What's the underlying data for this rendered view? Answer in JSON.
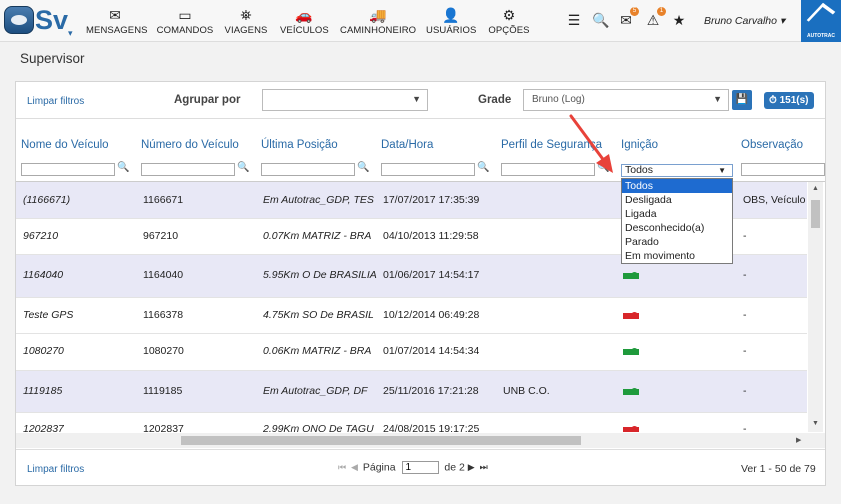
{
  "app": {
    "logo_text": "Sv",
    "logo_caret": "▾"
  },
  "nav": [
    {
      "icon": "✉",
      "label": "MENSAGENS"
    },
    {
      "icon": "▭",
      "label": "COMANDOS"
    },
    {
      "icon": "⛯",
      "label": "VIAGENS"
    },
    {
      "icon": "🚗",
      "label": "VEÍCULOS"
    },
    {
      "icon": "🚚",
      "label": "CAMINHONEIRO"
    },
    {
      "icon": "👤",
      "label": "USUÁRIOS"
    },
    {
      "icon": "⚙",
      "label": "OPÇÕES"
    }
  ],
  "top_icons": {
    "list": "☰",
    "search": "🔍",
    "mail": "✉",
    "mail_badge": "5",
    "alert": "⚠",
    "alert_badge": "1",
    "star": "★"
  },
  "user": {
    "name": "Bruno Carvalho ▾"
  },
  "brand": {
    "label": "AUTOTRAC"
  },
  "page": {
    "title": "Supervisor"
  },
  "toolbar": {
    "clear_filters": "Limpar filtros",
    "group_by_label": "Agrupar por",
    "group_by_value": "",
    "grade_label": "Grade",
    "grade_value": "Bruno (Log)",
    "save_icon": "💾",
    "count_badge": "⏱ 151(s)"
  },
  "columns": [
    "Nome do Veículo",
    "Número do Veículo",
    "Última Posição",
    "Data/Hora",
    "Perfil de Segurança",
    "Ignição",
    "Observação"
  ],
  "rows": [
    {
      "name": "(1166671)",
      "number": "1166671",
      "position": "Em Autotrac_GDP, TES",
      "datetime": "17/07/2017 17:35:39",
      "profile": "",
      "ignition": "",
      "obs": "OBS, Veículo"
    },
    {
      "name": "967210",
      "number": "967210",
      "position": "0.07Km MATRIZ - BRA",
      "datetime": "04/10/2013 11:29:58",
      "profile": "",
      "ignition": "",
      "obs": "-"
    },
    {
      "name": "1164040",
      "number": "1164040",
      "position": "5.95Km O De BRASILIA",
      "datetime": "01/06/2017 14:54:17",
      "profile": "",
      "ignition": "on",
      "obs": "-"
    },
    {
      "name": "Teste GPS",
      "number": "1166378",
      "position": "4.75Km SO De BRASIL",
      "datetime": "10/12/2014 06:49:28",
      "profile": "",
      "ignition": "off",
      "obs": "-"
    },
    {
      "name": "1080270",
      "number": "1080270",
      "position": "0.06Km MATRIZ - BRA",
      "datetime": "01/07/2014 14:54:34",
      "profile": "",
      "ignition": "on",
      "obs": "-"
    },
    {
      "name": "1119185",
      "number": "1119185",
      "position": "Em Autotrac_GDP, DF",
      "datetime": "25/11/2016 17:21:28",
      "profile": "UNB C.O.",
      "ignition": "on",
      "obs": "-"
    },
    {
      "name": "1202837",
      "number": "1202837",
      "position": "2.99Km ONO De TAGU",
      "datetime": "24/08/2015 19:17:25",
      "profile": "",
      "ignition": "off",
      "obs": "-"
    }
  ],
  "ignition_filter": {
    "value": "Todos",
    "options": [
      "Todos",
      "Desligada",
      "Ligada",
      "Desconhecido(a)",
      "Parado",
      "Em movimento"
    ]
  },
  "footer": {
    "clear_filters": "Limpar filtros",
    "page_label": "Página",
    "page_value": "1",
    "page_of": "de 2",
    "view_info": "Ver 1 - 50 de 79"
  },
  "colors": {
    "accent": "#2a6aa6",
    "ignition_on": "#1f9a3c",
    "ignition_off": "#d8262a",
    "annotation": "#e8423a"
  }
}
